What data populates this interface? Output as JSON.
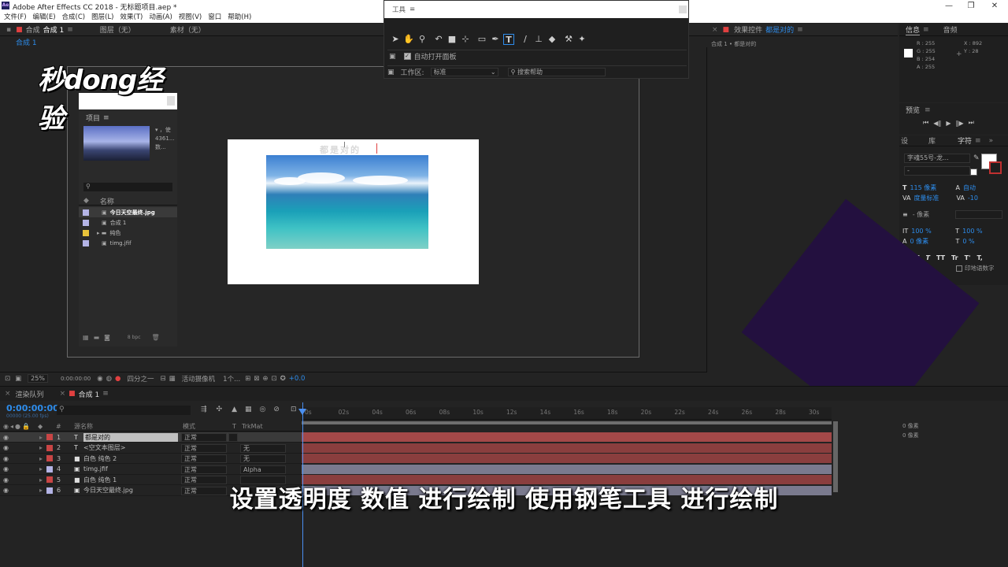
{
  "app": {
    "title": "Adobe After Effects CC 2018 - 无标题项目.aep *",
    "icon": "Ae",
    "window_controls": [
      "—",
      "❐",
      "✕"
    ]
  },
  "menu": [
    "文件(F)",
    "编辑(E)",
    "合成(C)",
    "图层(L)",
    "效果(T)",
    "动画(A)",
    "视图(V)",
    "窗口",
    "帮助(H)"
  ],
  "viewer": {
    "tabs": [
      "合成",
      "合成 1",
      "图层（无）",
      "素材（无）"
    ],
    "subtab": "合成 1",
    "bottom": {
      "zoom": "25%",
      "timecode": "0:00:00:00",
      "quality": "四分之一",
      "camera": "活动摄像机",
      "views": "1个...",
      "exposure": "+0.0"
    }
  },
  "logo_text": "秒dong经验",
  "project": {
    "title": "项目",
    "thumb_info": [
      "▾ ，使",
      "4361...",
      "数..."
    ],
    "col_name": "名称",
    "items": [
      {
        "name": "今日天空最终.jpg",
        "color": "#b4b4e6",
        "icon": "image-icon"
      },
      {
        "name": "合成 1",
        "color": "#b4b4e6",
        "icon": "comp-icon"
      },
      {
        "name": "纯色",
        "color": "#e8c33a",
        "icon": "folder-icon"
      },
      {
        "name": "timg.jfif",
        "color": "#b4b4e6",
        "icon": "image-icon"
      }
    ],
    "bpc": "8 bpc"
  },
  "ghost_text": "都是对的",
  "tools": {
    "title": "工具",
    "auto_open": "自动打开面板",
    "workspace_label": "工作区:",
    "workspace_value": "标准",
    "search_help": "搜索帮助"
  },
  "effects": {
    "title": "效果控件",
    "layer": "都是对的",
    "path": "合成 1 • 都是对的"
  },
  "info": {
    "tabs": [
      "信息",
      "音频"
    ],
    "r": "R : 255",
    "g": "G : 255",
    "b": "B : 254",
    "a": "A : 255",
    "x": "X : 892",
    "y": "Y : 28"
  },
  "preview": {
    "title": "预览"
  },
  "character": {
    "tabs": [
      "设",
      "库",
      "字符"
    ],
    "font": "字魂55号-龙...",
    "style": "-",
    "size": "115 像素",
    "leading": "自动",
    "tracking_label": "度量标准",
    "tracking": "-10",
    "stroke": "- 像素",
    "vscale": "100 %",
    "hscale": "100 %",
    "baseline": "0 像素",
    "tsume": "0 %",
    "styles": [
      "T",
      "T",
      "TT",
      "Tr",
      "T'",
      "T,"
    ],
    "indic": "印地语数字"
  },
  "timeline": {
    "tabs": [
      "渲染队列",
      "合成 1"
    ],
    "timecode": "0:00:00:00",
    "timecode_sub": "00000 (25.00 fps)",
    "columns": {
      "num": "#",
      "name": "源名称",
      "mode": "模式",
      "t": "T",
      "trkmat": "TrkMat"
    },
    "ruler": [
      "0s",
      "02s",
      "04s",
      "06s",
      "08s",
      "10s",
      "12s",
      "14s",
      "16s",
      "18s",
      "20s",
      "22s",
      "24s",
      "26s",
      "28s",
      "30s"
    ],
    "layers": [
      {
        "num": "1",
        "type": "T",
        "name": "都是对的",
        "mode": "正常",
        "trk": "",
        "color": "#c94545",
        "bar": "#a34848",
        "selected": true
      },
      {
        "num": "2",
        "type": "T",
        "name": "<空文本图层>",
        "mode": "正常",
        "trk": "无",
        "color": "#c94545",
        "bar": "#8a3e3e",
        "selected": false
      },
      {
        "num": "3",
        "type": "■",
        "name": "白色 纯色 2",
        "mode": "正常",
        "trk": "无",
        "color": "#c94545",
        "bar": "#8a3e3e",
        "selected": false
      },
      {
        "num": "4",
        "type": "▣",
        "name": "timg.jfif",
        "mode": "正常",
        "trk": "Alpha",
        "color": "#b4b4e6",
        "bar": "#7a7a8e",
        "selected": false
      },
      {
        "num": "5",
        "type": "■",
        "name": "白色 纯色 1",
        "mode": "正常",
        "trk": "",
        "color": "#c94545",
        "bar": "#8a3e3e",
        "selected": false
      },
      {
        "num": "6",
        "type": "▣",
        "name": "今日天空最终.jpg",
        "mode": "正常",
        "trk": "",
        "color": "#b4b4e6",
        "bar": "#7a7a8e",
        "selected": false
      }
    ],
    "right_values": [
      "0 像素",
      "0 像素"
    ]
  },
  "subtitle": "设置透明度 数值 进行绘制 使用钢笔工具 进行绘制"
}
